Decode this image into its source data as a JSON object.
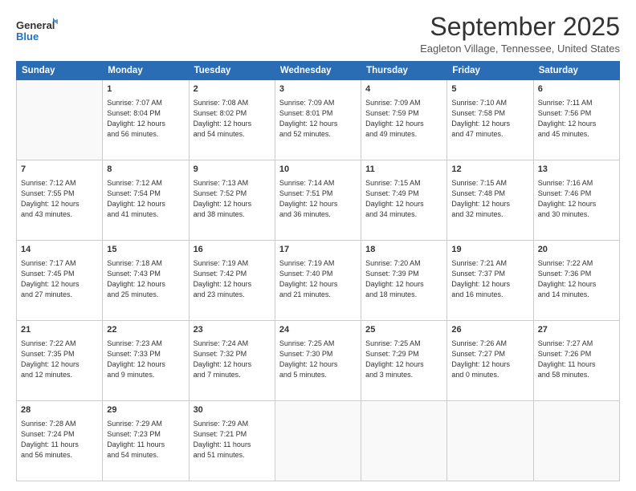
{
  "header": {
    "logo_line1": "General",
    "logo_line2": "Blue",
    "month": "September 2025",
    "location": "Eagleton Village, Tennessee, United States"
  },
  "days_of_week": [
    "Sunday",
    "Monday",
    "Tuesday",
    "Wednesday",
    "Thursday",
    "Friday",
    "Saturday"
  ],
  "weeks": [
    [
      {
        "day": "",
        "info": ""
      },
      {
        "day": "1",
        "info": "Sunrise: 7:07 AM\nSunset: 8:04 PM\nDaylight: 12 hours\nand 56 minutes."
      },
      {
        "day": "2",
        "info": "Sunrise: 7:08 AM\nSunset: 8:02 PM\nDaylight: 12 hours\nand 54 minutes."
      },
      {
        "day": "3",
        "info": "Sunrise: 7:09 AM\nSunset: 8:01 PM\nDaylight: 12 hours\nand 52 minutes."
      },
      {
        "day": "4",
        "info": "Sunrise: 7:09 AM\nSunset: 7:59 PM\nDaylight: 12 hours\nand 49 minutes."
      },
      {
        "day": "5",
        "info": "Sunrise: 7:10 AM\nSunset: 7:58 PM\nDaylight: 12 hours\nand 47 minutes."
      },
      {
        "day": "6",
        "info": "Sunrise: 7:11 AM\nSunset: 7:56 PM\nDaylight: 12 hours\nand 45 minutes."
      }
    ],
    [
      {
        "day": "7",
        "info": "Sunrise: 7:12 AM\nSunset: 7:55 PM\nDaylight: 12 hours\nand 43 minutes."
      },
      {
        "day": "8",
        "info": "Sunrise: 7:12 AM\nSunset: 7:54 PM\nDaylight: 12 hours\nand 41 minutes."
      },
      {
        "day": "9",
        "info": "Sunrise: 7:13 AM\nSunset: 7:52 PM\nDaylight: 12 hours\nand 38 minutes."
      },
      {
        "day": "10",
        "info": "Sunrise: 7:14 AM\nSunset: 7:51 PM\nDaylight: 12 hours\nand 36 minutes."
      },
      {
        "day": "11",
        "info": "Sunrise: 7:15 AM\nSunset: 7:49 PM\nDaylight: 12 hours\nand 34 minutes."
      },
      {
        "day": "12",
        "info": "Sunrise: 7:15 AM\nSunset: 7:48 PM\nDaylight: 12 hours\nand 32 minutes."
      },
      {
        "day": "13",
        "info": "Sunrise: 7:16 AM\nSunset: 7:46 PM\nDaylight: 12 hours\nand 30 minutes."
      }
    ],
    [
      {
        "day": "14",
        "info": "Sunrise: 7:17 AM\nSunset: 7:45 PM\nDaylight: 12 hours\nand 27 minutes."
      },
      {
        "day": "15",
        "info": "Sunrise: 7:18 AM\nSunset: 7:43 PM\nDaylight: 12 hours\nand 25 minutes."
      },
      {
        "day": "16",
        "info": "Sunrise: 7:19 AM\nSunset: 7:42 PM\nDaylight: 12 hours\nand 23 minutes."
      },
      {
        "day": "17",
        "info": "Sunrise: 7:19 AM\nSunset: 7:40 PM\nDaylight: 12 hours\nand 21 minutes."
      },
      {
        "day": "18",
        "info": "Sunrise: 7:20 AM\nSunset: 7:39 PM\nDaylight: 12 hours\nand 18 minutes."
      },
      {
        "day": "19",
        "info": "Sunrise: 7:21 AM\nSunset: 7:37 PM\nDaylight: 12 hours\nand 16 minutes."
      },
      {
        "day": "20",
        "info": "Sunrise: 7:22 AM\nSunset: 7:36 PM\nDaylight: 12 hours\nand 14 minutes."
      }
    ],
    [
      {
        "day": "21",
        "info": "Sunrise: 7:22 AM\nSunset: 7:35 PM\nDaylight: 12 hours\nand 12 minutes."
      },
      {
        "day": "22",
        "info": "Sunrise: 7:23 AM\nSunset: 7:33 PM\nDaylight: 12 hours\nand 9 minutes."
      },
      {
        "day": "23",
        "info": "Sunrise: 7:24 AM\nSunset: 7:32 PM\nDaylight: 12 hours\nand 7 minutes."
      },
      {
        "day": "24",
        "info": "Sunrise: 7:25 AM\nSunset: 7:30 PM\nDaylight: 12 hours\nand 5 minutes."
      },
      {
        "day": "25",
        "info": "Sunrise: 7:25 AM\nSunset: 7:29 PM\nDaylight: 12 hours\nand 3 minutes."
      },
      {
        "day": "26",
        "info": "Sunrise: 7:26 AM\nSunset: 7:27 PM\nDaylight: 12 hours\nand 0 minutes."
      },
      {
        "day": "27",
        "info": "Sunrise: 7:27 AM\nSunset: 7:26 PM\nDaylight: 11 hours\nand 58 minutes."
      }
    ],
    [
      {
        "day": "28",
        "info": "Sunrise: 7:28 AM\nSunset: 7:24 PM\nDaylight: 11 hours\nand 56 minutes."
      },
      {
        "day": "29",
        "info": "Sunrise: 7:29 AM\nSunset: 7:23 PM\nDaylight: 11 hours\nand 54 minutes."
      },
      {
        "day": "30",
        "info": "Sunrise: 7:29 AM\nSunset: 7:21 PM\nDaylight: 11 hours\nand 51 minutes."
      },
      {
        "day": "",
        "info": ""
      },
      {
        "day": "",
        "info": ""
      },
      {
        "day": "",
        "info": ""
      },
      {
        "day": "",
        "info": ""
      }
    ]
  ]
}
